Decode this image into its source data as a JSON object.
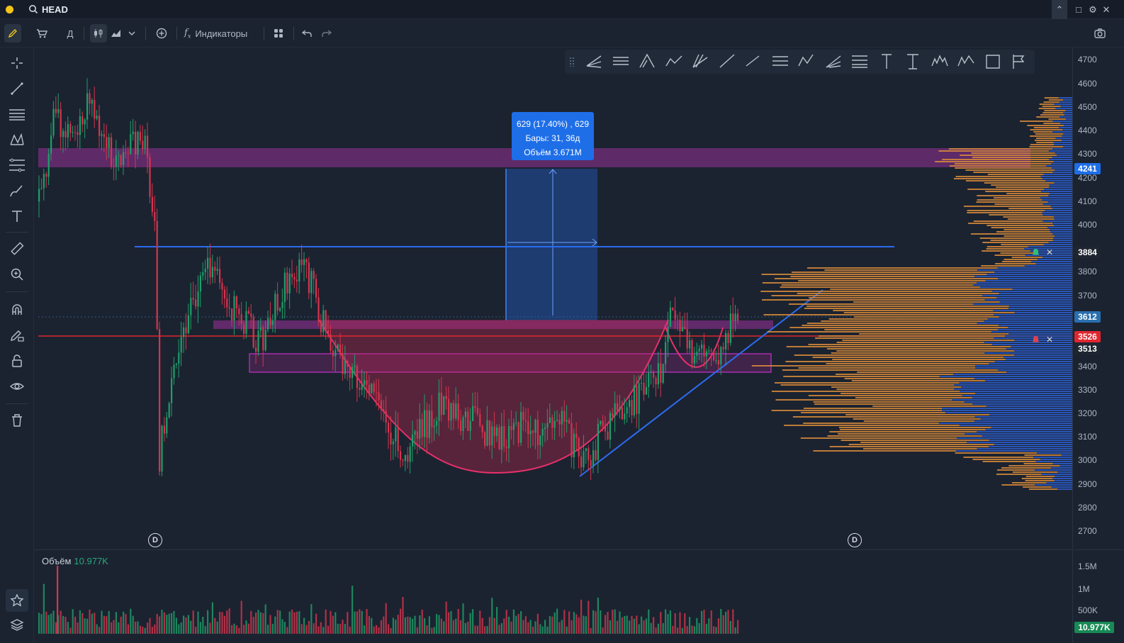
{
  "app": {
    "ticker": "HEAD"
  },
  "toolbar": {
    "timeframe": "Д",
    "indicators_label": "Индикаторы"
  },
  "measure_tooltip": {
    "line1": "629 (17.40%) , 629",
    "line2": "Бары: 31, 36д",
    "line3": "Объём 3.671M"
  },
  "volume_pane": {
    "label": "Объём",
    "value": "10.977K",
    "axis_ticks": [
      "1.5M",
      "1M",
      "500K"
    ],
    "current_badge": "10.977K"
  },
  "price_axis": {
    "ticks": [
      "4700",
      "4600",
      "4500",
      "4400",
      "4300",
      "4200",
      "4100",
      "4000",
      "3800",
      "3700",
      "3400",
      "3300",
      "3200",
      "3100",
      "3000",
      "2900",
      "2800",
      "2700"
    ],
    "badges": [
      {
        "label": "4241",
        "color": "#1e6ee8"
      },
      {
        "label": "3884",
        "color": "#1f2631"
      },
      {
        "label": "3612",
        "color": "#2a6fb0"
      },
      {
        "label": "3526",
        "color": "#e0262f"
      },
      {
        "label": "3513",
        "color": "#1f2631"
      }
    ]
  },
  "event_markers": [
    "D",
    "D"
  ],
  "colors": {
    "background": "#1b2330",
    "up": "#1f9e6a",
    "down": "#d6344e",
    "zone": "#7a2e7e",
    "accent_blue": "#1e6ee8",
    "alert_red": "#e0262f",
    "profile_orange": "#d98b3a",
    "profile_blue": "#2c5cc9"
  },
  "icons": {
    "left_toolbar": [
      "crosshair-icon",
      "trendline-icon",
      "horizontal-lines-icon",
      "pattern-icon",
      "fib-icon",
      "brush-icon",
      "text-icon",
      "ruler-icon",
      "zoom-icon",
      "magnet-icon",
      "lock-drawing-icon",
      "lock-icon",
      "eye-icon",
      "trash-icon",
      "star-icon",
      "layers-icon"
    ],
    "drawing_toolbar": [
      "pitchfork-icon",
      "parallel-channel-icon",
      "fan-icon",
      "zigzag-icon",
      "gann-icon",
      "ray-icon",
      "line-icon",
      "fib-retracement-icon",
      "abc-pattern-icon",
      "fib-fan-icon",
      "fib-channel-icon",
      "text-tool-icon",
      "anchored-text-icon",
      "elliott-icon",
      "wave-icon",
      "rectangle-icon",
      "date-range-icon"
    ]
  }
}
